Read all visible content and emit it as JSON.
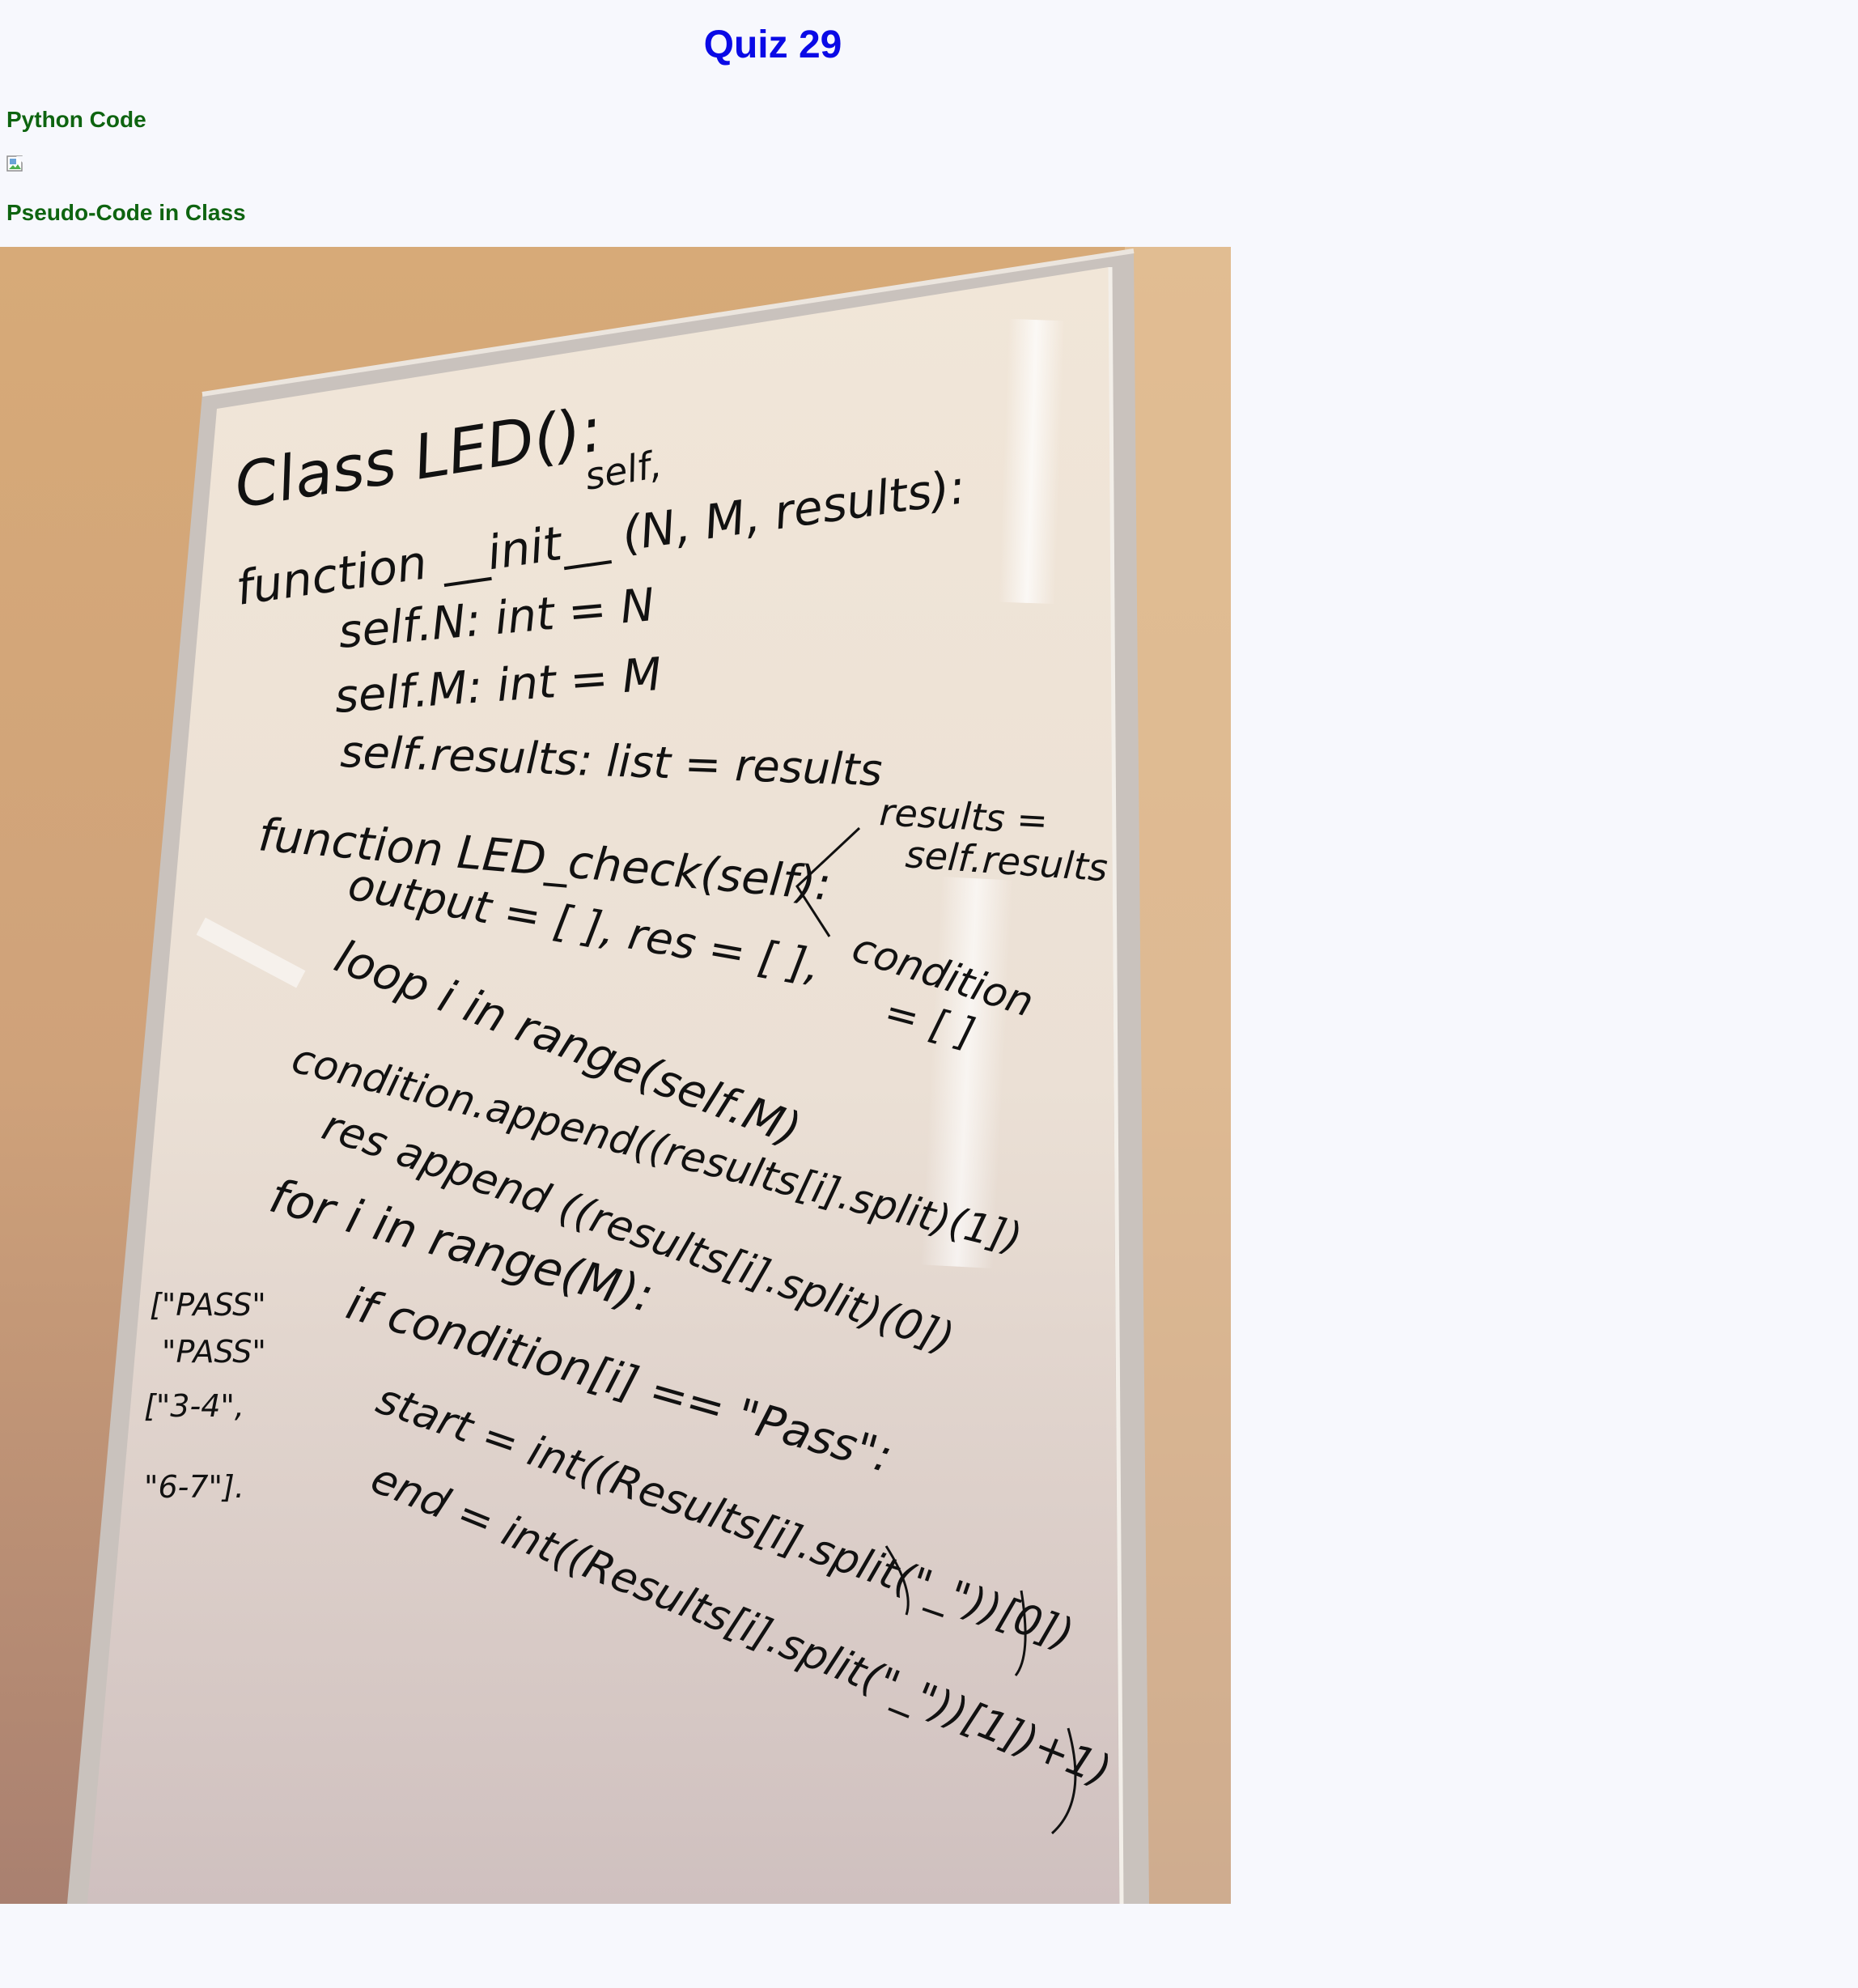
{
  "page": {
    "title": "Quiz 29",
    "sections": [
      {
        "heading": "Python Code"
      },
      {
        "heading": "Pseudo-Code in Class"
      }
    ]
  },
  "whiteboard": {
    "lines": [
      "Class LED():",
      "self,",
      "function __init__ (N, M, results):",
      "self.N: int = N",
      "self.M: int = M",
      "self.results: list = results",
      "function LED_check(self):",
      "results =",
      "self.results",
      "output = [ ], res = [ ],",
      "condition",
      "= [ ]",
      "loop i in range(self.M)",
      "condition.append((results[i].split)(1])",
      "res append ((results[i].split)(0])",
      "for i in range(M):",
      "if condition[i] == \"Pass\":",
      "start = int((Results[i].split(\"_\"))[0])",
      "end = int((Results[i].split(\"_\"))[1])+1)",
      "[\"PASS\"",
      "\"PASS\"",
      "[\"3-4\",",
      "\"6-7\"]."
    ]
  },
  "colors": {
    "title": "#0a0ae6",
    "heading": "#0e6410",
    "background": "#f7f8fd"
  }
}
